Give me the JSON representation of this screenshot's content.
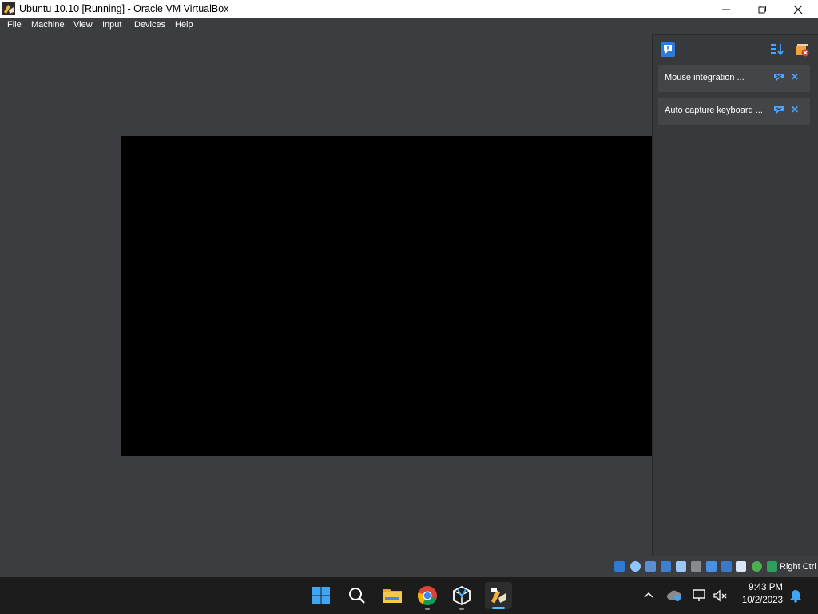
{
  "window": {
    "title": "Ubuntu 10.10 [Running] - Oracle VM VirtualBox",
    "app_icon": "virtualbox-icon",
    "controls": {
      "minimize": "minimize-icon",
      "maximize": "maximize-icon",
      "close": "close-icon"
    }
  },
  "menu": {
    "items": [
      {
        "label": "File"
      },
      {
        "label": "Machine"
      },
      {
        "label": "View"
      },
      {
        "label": "Input"
      },
      {
        "label": "Devices"
      },
      {
        "label": "Help"
      }
    ]
  },
  "notification_center": {
    "toolbar_icons": [
      "message-icon",
      "sort-icon",
      "clear-icon"
    ],
    "notifications": [
      {
        "text": "Mouse integration ..."
      },
      {
        "text": "Auto capture keyboard ..."
      }
    ],
    "accent": "#4aa3ff"
  },
  "statusbar": {
    "icons": [
      "hard-disk-icon",
      "optical-drive-icon",
      "audio-icon",
      "network-icon",
      "usb-icon",
      "shared-folders-icon",
      "display-icon",
      "recording-icon",
      "vt-x-icon",
      "guest-additions-icon",
      "keyboard-capture-icon"
    ],
    "host_key": "Right Ctrl"
  },
  "taskbar": {
    "apps": [
      "windows-start-icon",
      "search-icon",
      "file-explorer-icon",
      "chrome-icon",
      "virtualbox-manager-icon",
      "virtualbox-vm-icon"
    ],
    "tray": {
      "time": "9:43 PM",
      "date": "10/2/2023"
    }
  }
}
